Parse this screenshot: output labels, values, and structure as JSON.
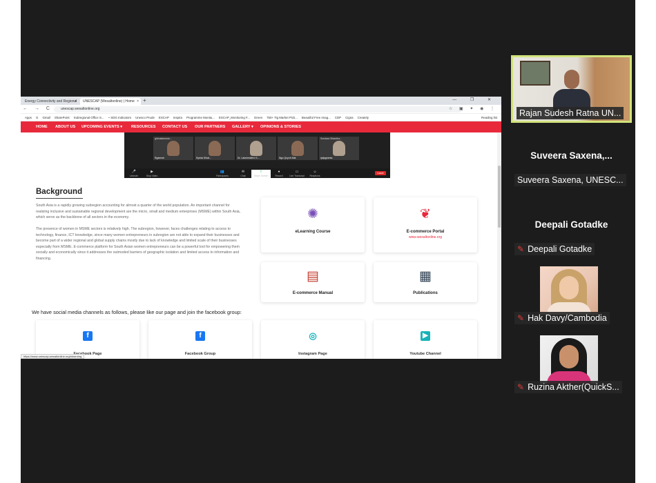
{
  "browser": {
    "tabs": [
      {
        "label": "Energy Connectivity and Regional",
        "close": "×"
      },
      {
        "label": "UNESCAP (Wesaltonline) | Home",
        "close": "×"
      }
    ],
    "new_tab": "+",
    "window_controls": "— ❐ ✕",
    "nav_buttons": "← → C ⌂",
    "url": "unescap.wesaltonline.org",
    "extension_icons": "☆ ▣ ✦ ◉ ⋮",
    "bookmarks": [
      "Apps",
      "G",
      "Gmail",
      "SharePoint",
      "Subregional Office S...",
      "~ SDG Indicators",
      "Unesco Prude",
      "ESCAP",
      "Inspira",
      "Programme Monitu...",
      "ESCAP_Monitoring F...",
      "Green",
      "750+ Tig Market Pick...",
      "Beautiful Free Imag...",
      "CDP",
      "Cigna",
      "Creately"
    ],
    "reading_list": "Reading list"
  },
  "site_nav": [
    "HOME",
    "ABOUT US",
    "UPCOMING EVENTS ▾",
    "RESOURCES",
    "CONTACT US",
    "OUR PARTNERS",
    "GALLERY ▾",
    "OPINIONS & STORIES"
  ],
  "embedded_meeting": {
    "tiles": [
      {
        "name": "ghimatshendo...",
        "label": "Rganesh"
      },
      {
        "name": "",
        "label": "Syeda Shiat..."
      },
      {
        "name": "",
        "label": "Dr. Lakshmidevi G..."
      },
      {
        "name": "",
        "label": "Ngo Quynh Mai"
      },
      {
        "name": "Sundara Shiantha...",
        "label": "rjalpgramtu"
      }
    ],
    "controls": [
      "Unmute",
      "Stop Video",
      "Participants",
      "Chat",
      "Share Screen",
      "Record",
      "Live Transcript",
      "Reactions"
    ],
    "leave": "Leave"
  },
  "background": {
    "title": "Background",
    "p1": "South Asia is a rapidly growing subregion accounting for almost a quarter of the world population. An important channel for realizing inclusive and sustainable regional development are the micro, small and medium enterprises (MSME) within South Asia, which serve as the backbone of all sectors in the economy.",
    "p2": "The presence of women in MSME sectors is relatively high. The subregion, however, faces challenges relating to access to technology, finance, ICT knowledge, since many women entrepreneurs in subregion are not able to expand their businesses and become part of a wider regional and global supply chains mostly due to lack of knowledge and limited scale of their businesses especially from MSME. E-commerce platform for South Asian women entrepreneurs can be a powerful tool for empowering them socially and economically since it addresses the outmoded barriers of geographic isolation and limited access to information and financing."
  },
  "resource_cards": [
    {
      "icon": "elearning-icon",
      "title": "eLearning Course",
      "subtitle": ""
    },
    {
      "icon": "ecommerce-portal-icon",
      "title": "E-commerce Portal",
      "subtitle": "www.wesaltonline.org"
    },
    {
      "icon": "manual-icon",
      "title": "E-commerce Manual",
      "subtitle": ""
    },
    {
      "icon": "publications-icon",
      "title": "Publications",
      "subtitle": ""
    }
  ],
  "social": {
    "intro": "We have social media channels as follows, please like our page and join the facebook group:",
    "cards": [
      {
        "icon": "facebook-icon",
        "glyph": "f",
        "label": "Facebook Page",
        "color": "#1877f2"
      },
      {
        "icon": "facebook-icon",
        "glyph": "f",
        "label": "Facebook Group",
        "color": "#1877f2"
      },
      {
        "icon": "instagram-icon",
        "glyph": "◎",
        "label": "Instagram Page",
        "color": "#17b3b8"
      },
      {
        "icon": "youtube-icon",
        "glyph": "▶",
        "label": "Youtube Channel",
        "color": "#17b3b8"
      }
    ]
  },
  "status_url": "https://www.unescap.wesaltonline.org/elearning",
  "participants": [
    {
      "name": "Rajan Sudesh Ratna UN...",
      "active": true
    },
    {
      "big": "Suveera  Saxena,...",
      "name": "Suveera Saxena, UNESC...",
      "muted": false
    },
    {
      "big": "Deepali Gotadke",
      "name": "Deepali Gotadke",
      "muted": true
    },
    {
      "name": "Hak Davy/Cambodia",
      "muted": true
    },
    {
      "name": "Ruzina Akther(QuickS...",
      "muted": true
    }
  ],
  "mic_muted_glyph": "🎙",
  "colors": {
    "nav_red": "#e8293b",
    "active_speaker_border": "#d2e37c",
    "meeting_bg": "#1c1c1c"
  }
}
